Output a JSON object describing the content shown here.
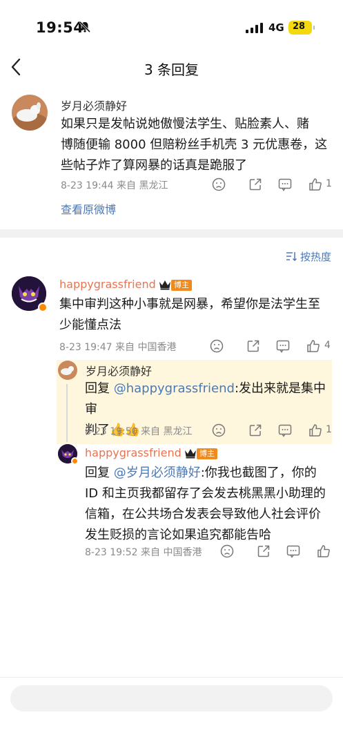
{
  "status_bar": {
    "time": "19:54",
    "network": "4G",
    "battery": "28"
  },
  "nav": {
    "title": "3 条回复"
  },
  "main_comment": {
    "user": "岁月必须静好",
    "lines": [
      "如果只是发帖说她傲慢法学生、贴脸素人、赌",
      "博随便输 8000 但赔粉丝手机壳 3 元优惠卷，这",
      "些帖子炸了算网暴的话真是跪服了"
    ],
    "meta": "8-23 19:44  来自 黑龙江",
    "likes": "1",
    "view_original": "查看原微博"
  },
  "sort_label": "按热度",
  "replies": [
    {
      "user": "happygrassfriend",
      "badge": "博主",
      "lines": [
        "集中审判这种小事就是网暴，希望你是法学生至",
        "少能懂点法"
      ],
      "meta": "8-23 19:47  来自 中国香港",
      "likes": "4"
    },
    {
      "user": "岁月必须静好",
      "reply_prefix": "回复 ",
      "mention": "@happygrassfriend",
      "line1_rest": ":发出来就是集中审",
      "line2": "判了👍👍",
      "meta": "8-23 19:50  来自 黑龙江",
      "likes": "1"
    },
    {
      "user": "happygrassfriend",
      "badge": "博主",
      "reply_prefix": "回复 ",
      "mention": "@岁月必须静好",
      "line1_rest": ":你我也截图了，你的",
      "lines": [
        "ID 和主页我都留存了会发去桃黑黑小助理的",
        "信箱，在公共场合发表会导致他人社会评价",
        "发生贬损的言论如果追究都能告哈"
      ],
      "meta": "8-23 19:52  来自 中国香港"
    }
  ],
  "bottom": {
    "placeholder": ""
  },
  "colors": {
    "accent": "#eb7350",
    "link": "#4b79b5",
    "highlight": "#fff7dd"
  }
}
